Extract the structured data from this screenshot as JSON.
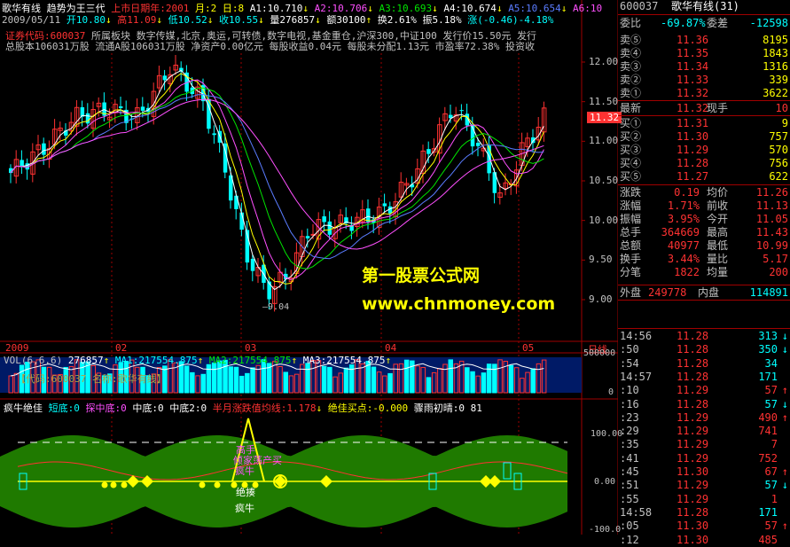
{
  "header": {
    "stock_name": "歌华有线",
    "indicator_name": "趋势为王三代",
    "ipo_label": "上市日期年:2001",
    "month_label": "月:2",
    "day_label": "日:8",
    "a1": "A1:10.710",
    "a2": "A2:10.706",
    "a3": "A3:10.693",
    "a4": "A4:10.674",
    "a5": "A5:10.654",
    "a6": "A6:10",
    "date": "2009/05/11",
    "open": "开10.80",
    "high": "高11.09",
    "low": "低10.52",
    "close": "收10.55",
    "volume": "量276857",
    "amount": "额30100",
    "turnover": "换2.61%",
    "amplitude": "振5.18%",
    "change": "涨(-0.46)-4.18%"
  },
  "info_lines": {
    "line1_code": "证券代码:600037",
    "line1_rest": "所属板块 数字传媒,北京,奥运,可转债,数字电视,基金重仓,沪深300,中证100  发行价15.50元  发行",
    "line2": "总股本106031万股  流通A股106031万股  净资产0.00亿元  每股收益0.04元  每股未分配1.13元  市盈率72.38%  投资收"
  },
  "price_axis": [
    "12.00",
    "11.50",
    "11.00",
    "10.50",
    "10.00",
    "9.50",
    "9.00"
  ],
  "current_price_tag": "11.32",
  "watermark": {
    "line1": "第一股票公式网",
    "line2": "www.chnmoney.com"
  },
  "low_label": "9.04",
  "time_axis": [
    "2009",
    "02",
    "03",
    "04",
    "05"
  ],
  "time_axis_right": "日线",
  "volume_panel": {
    "title": "VOL(6,6,6)",
    "vol": "276857",
    "ma1": "MA1:217554.875",
    "ma2": "MA2:217554.875",
    "ma3": "MA3:217554.875",
    "code_label": "【代码:600037 名称:歌华有线】",
    "axis": [
      "500000",
      "0"
    ]
  },
  "bottom_panel": {
    "title": "疯牛绝佳",
    "items": [
      "短底:0",
      "探中底:0",
      "中底:0",
      "中底2:0",
      "半月涨跌值均线:1.178",
      "绝佳买点:-0.000",
      "骤雨初晴:0 81"
    ],
    "annotations": [
      "高手",
      "倾家荡产买",
      "疯牛",
      "绝揍",
      "疯牛"
    ],
    "axis": [
      "100.00",
      "0.00",
      "-100.0"
    ]
  },
  "quote": {
    "code": "600037",
    "name": "歌华有线(31)",
    "ratio_label": "委比",
    "ratio": "-69.87%",
    "diff_label": "委差",
    "diff": "-12598",
    "asks": [
      {
        "label": "卖⑤",
        "price": "11.36",
        "vol": "8195"
      },
      {
        "label": "卖④",
        "price": "11.35",
        "vol": "1843"
      },
      {
        "label": "卖③",
        "price": "11.34",
        "vol": "1316"
      },
      {
        "label": "卖②",
        "price": "11.33",
        "vol": "339"
      },
      {
        "label": "卖①",
        "price": "11.32",
        "vol": "3622"
      }
    ],
    "last_label": "最新",
    "last": "11.32",
    "hand_label": "现手",
    "hand": "10",
    "bids": [
      {
        "label": "买①",
        "price": "11.31",
        "vol": "9"
      },
      {
        "label": "买②",
        "price": "11.30",
        "vol": "757"
      },
      {
        "label": "买③",
        "price": "11.29",
        "vol": "570"
      },
      {
        "label": "买④",
        "price": "11.28",
        "vol": "756"
      },
      {
        "label": "买⑤",
        "price": "11.27",
        "vol": "622"
      }
    ],
    "stats": [
      {
        "l1": "涨跌",
        "v1": "0.19",
        "l2": "均价",
        "v2": "11.26"
      },
      {
        "l1": "涨幅",
        "v1": "1.71%",
        "l2": "前收",
        "v2": "11.13"
      },
      {
        "l1": "振幅",
        "v1": "3.95%",
        "l2": "今开",
        "v2": "11.05"
      },
      {
        "l1": "总手",
        "v1": "364669",
        "l2": "最高",
        "v2": "11.43"
      },
      {
        "l1": "总额",
        "v1": "40977",
        "l2": "最低",
        "v2": "10.99"
      },
      {
        "l1": "换手",
        "v1": "3.44%",
        "l2": "量比",
        "v2": "5.17"
      },
      {
        "l1": "分笔",
        "v1": "1822",
        "l2": "均量",
        "v2": "200"
      }
    ],
    "outer_label": "外盘",
    "outer": "249778",
    "inner_label": "内盘",
    "inner": "114891",
    "ticks": [
      {
        "time": "14:56",
        "price": "11.28",
        "vol": "313",
        "arr": "↓",
        "dir": "down"
      },
      {
        "time": ":50",
        "price": "11.28",
        "vol": "350",
        "arr": "↓",
        "dir": "down"
      },
      {
        "time": ":54",
        "price": "11.28",
        "vol": "34",
        "arr": "",
        "dir": "down"
      },
      {
        "time": "14:57",
        "price": "11.28",
        "vol": "171",
        "arr": "",
        "dir": "down"
      },
      {
        "time": ":10",
        "price": "11.29",
        "vol": "57",
        "arr": "↑",
        "dir": "up"
      },
      {
        "time": ":16",
        "price": "11.28",
        "vol": "57",
        "arr": "↓",
        "dir": "down"
      },
      {
        "time": ":23",
        "price": "11.29",
        "vol": "490",
        "arr": "↑",
        "dir": "up"
      },
      {
        "time": ":29",
        "price": "11.29",
        "vol": "741",
        "arr": "",
        "dir": "up"
      },
      {
        "time": ":35",
        "price": "11.29",
        "vol": "7",
        "arr": "",
        "dir": "up"
      },
      {
        "time": ":41",
        "price": "11.29",
        "vol": "752",
        "arr": "",
        "dir": "up"
      },
      {
        "time": ":45",
        "price": "11.30",
        "vol": "67",
        "arr": "↑",
        "dir": "up"
      },
      {
        "time": ":51",
        "price": "11.29",
        "vol": "57",
        "arr": "↓",
        "dir": "down"
      },
      {
        "time": ":55",
        "price": "11.29",
        "vol": "1",
        "arr": "",
        "dir": "up"
      },
      {
        "time": "14:58",
        "price": "11.28",
        "vol": "171",
        "arr": "",
        "dir": "down"
      },
      {
        "time": ":05",
        "price": "11.30",
        "vol": "57",
        "arr": "↑",
        "dir": "up"
      },
      {
        "time": ":12",
        "price": "11.30",
        "vol": "485",
        "arr": "",
        "dir": "up"
      }
    ]
  },
  "colors": {
    "up": "#ff3232",
    "down": "#00ffff",
    "grid": "#a00000",
    "ma": "#ffff00"
  }
}
